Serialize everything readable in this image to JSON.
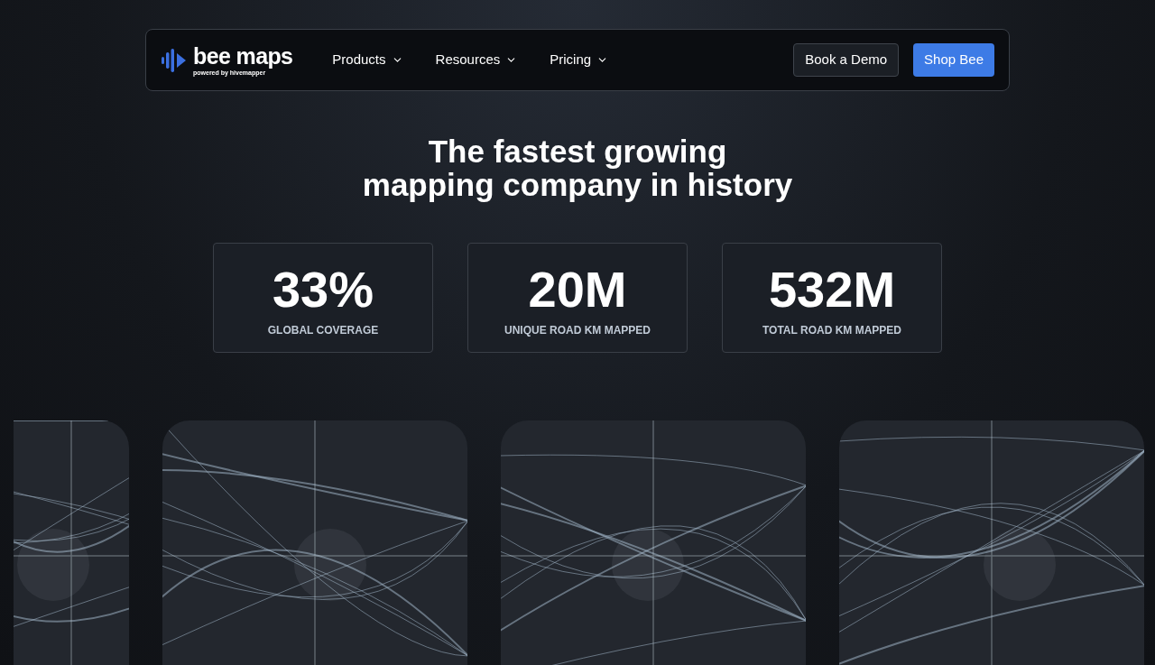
{
  "nav": {
    "logo": {
      "name": "bee maps",
      "tagline": "powered by hivemapper"
    },
    "menu": [
      {
        "label": "Products"
      },
      {
        "label": "Resources"
      },
      {
        "label": "Pricing"
      }
    ],
    "buttons": [
      {
        "label": "Book a Demo",
        "kind": "secondary"
      },
      {
        "label": "Shop Bee",
        "kind": "primary"
      }
    ]
  },
  "headline": [
    "The fastest growing",
    "mapping company in history"
  ],
  "stats": [
    {
      "value": "33%",
      "label": "GLOBAL COVERAGE"
    },
    {
      "value": "20M",
      "label": "UNIQUE ROAD KM MAPPED"
    },
    {
      "value": "532M",
      "label": "TOTAL ROAD KM MAPPED"
    }
  ],
  "maps": [
    {
      "kind": "picture"
    },
    {
      "kind": "picture"
    },
    {
      "kind": "picture"
    },
    {
      "kind": "picture"
    }
  ]
}
